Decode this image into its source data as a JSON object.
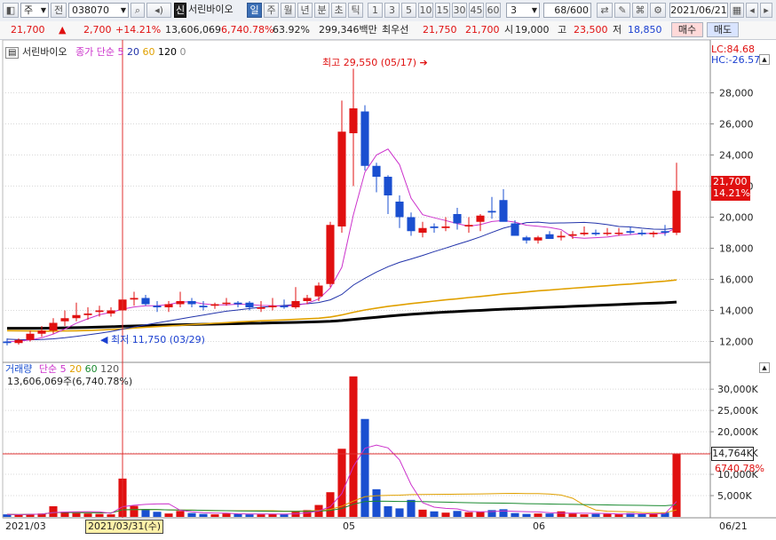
{
  "toolbar": {
    "market": "주",
    "prev_label": "전",
    "code": "038070",
    "stock_badge": "신",
    "stock_name": "서린바이오",
    "periods": [
      "일",
      "주",
      "월",
      "년",
      "분",
      "초",
      "틱"
    ],
    "intervals": [
      "1",
      "3",
      "5",
      "10",
      "15",
      "30",
      "45",
      "60"
    ],
    "interval_value": "3",
    "count": "68",
    "total": "/600",
    "date": "2021/06/21"
  },
  "quote": {
    "price": "21,700",
    "change": "2,700",
    "change_pct": "+14.21%",
    "volume": "13,606,069",
    "volume_pct": "6,740.78%",
    "ratio": "63.92%",
    "amount": "299,346백만",
    "best_label": "최우선",
    "best_sell": "21,750",
    "best_buy": "21,700",
    "open_label": "시",
    "open": "19,000",
    "high_label": "고",
    "high": "23,500",
    "low_label": "저",
    "low": "18,850",
    "buy_button": "매수",
    "sell_button": "매도"
  },
  "price_panel": {
    "name": "서린바이오",
    "ma_label": "종가 단순",
    "ma_periods": [
      "5",
      "20",
      "60",
      "120",
      "0"
    ],
    "lc": "LC:84.68",
    "hc": "HC:-26.57",
    "max_annotation": "최고 29,550 (05/17)",
    "min_annotation": "최저 11,750 (03/29)",
    "current_price_tag": "21,700",
    "current_pct_tag": "14.21%",
    "y_ticks": [
      "28,000",
      "26,000",
      "24,000",
      "22,000",
      "20,000",
      "18,000",
      "16,000",
      "14,000",
      "12,000"
    ]
  },
  "volume_panel": {
    "title": "거래량",
    "ma_label": "단순",
    "ma_periods": [
      "5",
      "20",
      "60",
      "120"
    ],
    "current": "13,606,069주(6,740.78%)",
    "tag_value": "14,764K",
    "tag_pct": "6740.78%",
    "y_ticks": [
      "30,000K",
      "25,000K",
      "20,000K",
      "15,000K",
      "10,000K",
      "5,000K"
    ]
  },
  "x_axis": {
    "labels": [
      "2021/03",
      "05",
      "06",
      "06/21"
    ],
    "crosshair_date": "2021/03/31(수)"
  },
  "colors": {
    "up": "#e01010",
    "down": "#1a4fd0",
    "ma5": "#cc33cc",
    "ma20": "#2233aa",
    "ma60": "#e0a000",
    "ma120": "#000000"
  },
  "chart_data": {
    "type": "candlestick",
    "dates": [
      "03/29",
      "03/30",
      "03/31",
      "04/01",
      "04/02",
      "04/05",
      "04/06",
      "04/07",
      "04/08",
      "04/09",
      "04/12",
      "04/13",
      "04/14",
      "04/15",
      "04/16",
      "04/19",
      "04/20",
      "04/21",
      "04/22",
      "04/23",
      "04/26",
      "04/27",
      "04/28",
      "04/29",
      "04/30",
      "05/03",
      "05/04",
      "05/06",
      "05/07",
      "05/10",
      "05/11",
      "05/12",
      "05/13",
      "05/14",
      "05/17",
      "05/18",
      "05/20",
      "05/21",
      "05/24",
      "05/25",
      "05/26",
      "05/27",
      "05/28",
      "05/31",
      "06/01",
      "06/02",
      "06/03",
      "06/04",
      "06/07",
      "06/08",
      "06/09",
      "06/10",
      "06/11",
      "06/14",
      "06/15",
      "06/16",
      "06/17",
      "06/18",
      "06/21"
    ],
    "open": [
      12000,
      11900,
      12100,
      12500,
      12700,
      13300,
      13500,
      13700,
      13900,
      13800,
      14000,
      14700,
      14800,
      14300,
      14200,
      14400,
      14600,
      14300,
      14300,
      14500,
      14500,
      14500,
      14100,
      14200,
      14300,
      14200,
      14600,
      14900,
      15700,
      19400,
      25400,
      26800,
      23300,
      22600,
      21000,
      20000,
      19000,
      19400,
      19300,
      20200,
      19400,
      19700,
      20400,
      21100,
      19600,
      18700,
      18500,
      18900,
      18700,
      18800,
      18900,
      19000,
      19000,
      19000,
      19100,
      19000,
      18900,
      19100,
      19000
    ],
    "high": [
      12200,
      12200,
      12700,
      13000,
      13500,
      14000,
      14500,
      14200,
      14300,
      14200,
      17600,
      15200,
      15000,
      14600,
      14600,
      15200,
      14800,
      14600,
      14500,
      14800,
      14600,
      14600,
      14600,
      14800,
      14700,
      15500,
      15000,
      15800,
      19700,
      27500,
      29550,
      27200,
      23500,
      22700,
      21400,
      20300,
      19700,
      19600,
      20000,
      20600,
      20000,
      20200,
      21300,
      21800,
      19800,
      18800,
      18800,
      19100,
      19100,
      19100,
      19400,
      19200,
      19300,
      19300,
      19400,
      19200,
      19100,
      19500,
      23500
    ],
    "low": [
      11750,
      11800,
      12000,
      12300,
      12500,
      13000,
      13300,
      13400,
      13600,
      13600,
      13800,
      14300,
      14300,
      13900,
      13900,
      14200,
      14200,
      14000,
      14100,
      14300,
      14200,
      14000,
      13900,
      14000,
      14100,
      14100,
      14400,
      14600,
      15500,
      19000,
      22000,
      23000,
      21600,
      20200,
      19300,
      18800,
      18700,
      19000,
      19100,
      19200,
      19000,
      19100,
      19900,
      20200,
      18800,
      18300,
      18300,
      18600,
      18500,
      18600,
      18800,
      18800,
      18800,
      18800,
      18900,
      18800,
      18700,
      18800,
      18850
    ],
    "close": [
      11900,
      12100,
      12500,
      12700,
      13200,
      13500,
      13700,
      13800,
      14000,
      14000,
      14700,
      14800,
      14400,
      14200,
      14400,
      14600,
      14400,
      14200,
      14400,
      14500,
      14400,
      14200,
      14200,
      14300,
      14200,
      14600,
      14800,
      15600,
      19500,
      25500,
      27000,
      23300,
      22600,
      21400,
      20000,
      19100,
      19300,
      19300,
      19400,
      19600,
      19500,
      20100,
      20300,
      19700,
      18800,
      18500,
      18700,
      18600,
      18800,
      18900,
      19000,
      18900,
      19000,
      19000,
      19000,
      18900,
      19000,
      19000,
      21700
    ],
    "volume_k": [
      600,
      500,
      700,
      800,
      2500,
      1200,
      900,
      800,
      700,
      600,
      9000,
      2600,
      1800,
      1200,
      800,
      1400,
      900,
      700,
      600,
      800,
      700,
      600,
      600,
      700,
      600,
      1200,
      1600,
      2800,
      5800,
      16000,
      33000,
      23000,
      6500,
      2500,
      2000,
      4000,
      1700,
      1300,
      1000,
      1400,
      1100,
      1200,
      1600,
      1800,
      900,
      700,
      800,
      800,
      1300,
      800,
      600,
      700,
      700,
      600,
      900,
      700,
      700,
      1000,
      14764
    ],
    "ma5": [
      11980,
      12020,
      12100,
      12240,
      12480,
      12800,
      13180,
      13460,
      13720,
      13880,
      14080,
      14220,
      14300,
      14300,
      14380,
      14540,
      14560,
      14420,
      14360,
      14360,
      14400,
      14380,
      14320,
      14310,
      14280,
      14320,
      14450,
      14740,
      15440,
      16780,
      20150,
      22900,
      24000,
      24380,
      23380,
      21220,
      20160,
      19960,
      19780,
      19580,
      19420,
      19520,
      19720,
      19780,
      19680,
      19480,
      19420,
      19340,
      19200,
      18700,
      18640,
      18680,
      18720,
      18830,
      18880,
      18940,
      18960,
      18960,
      19320
    ],
    "ma20": [
      12150,
      12120,
      12110,
      12130,
      12170,
      12240,
      12330,
      12430,
      12530,
      12640,
      12800,
      12940,
      13070,
      13200,
      13320,
      13450,
      13580,
      13700,
      13830,
      13950,
      14030,
      14120,
      14200,
      14260,
      14320,
      14380,
      14430,
      14510,
      14680,
      15030,
      15630,
      16070,
      16470,
      16810,
      17090,
      17310,
      17540,
      17780,
      18010,
      18250,
      18480,
      18730,
      19020,
      19290,
      19480,
      19650,
      19680,
      19620,
      19630,
      19640,
      19660,
      19620,
      19520,
      19400,
      19370,
      19290,
      19230,
      19220,
      19300
    ],
    "ma60": [
      12700,
      12690,
      12680,
      12670,
      12670,
      12680,
      12690,
      12710,
      12740,
      12770,
      12810,
      12870,
      12920,
      12960,
      13000,
      13040,
      13090,
      13130,
      13170,
      13210,
      13260,
      13300,
      13330,
      13360,
      13390,
      13420,
      13460,
      13500,
      13580,
      13710,
      13880,
      14030,
      14150,
      14260,
      14350,
      14440,
      14520,
      14600,
      14680,
      14750,
      14830,
      14900,
      14980,
      15060,
      15120,
      15190,
      15260,
      15310,
      15370,
      15430,
      15480,
      15540,
      15590,
      15650,
      15700,
      15760,
      15820,
      15880,
      15960
    ],
    "ma120": [
      12850,
      12850,
      12850,
      12850,
      12860,
      12880,
      12890,
      12910,
      12930,
      12950,
      12980,
      13000,
      13020,
      13040,
      13060,
      13080,
      13090,
      13110,
      13120,
      13140,
      13150,
      13170,
      13180,
      13200,
      13210,
      13230,
      13250,
      13270,
      13300,
      13350,
      13420,
      13490,
      13560,
      13630,
      13690,
      13750,
      13800,
      13850,
      13890,
      13930,
      13970,
      14000,
      14040,
      14080,
      14110,
      14140,
      14170,
      14200,
      14230,
      14260,
      14290,
      14320,
      14350,
      14380,
      14410,
      14440,
      14460,
      14490,
      14540
    ],
    "ylim": [
      11400,
      29800
    ],
    "volume_ylim": [
      0,
      34000
    ]
  }
}
